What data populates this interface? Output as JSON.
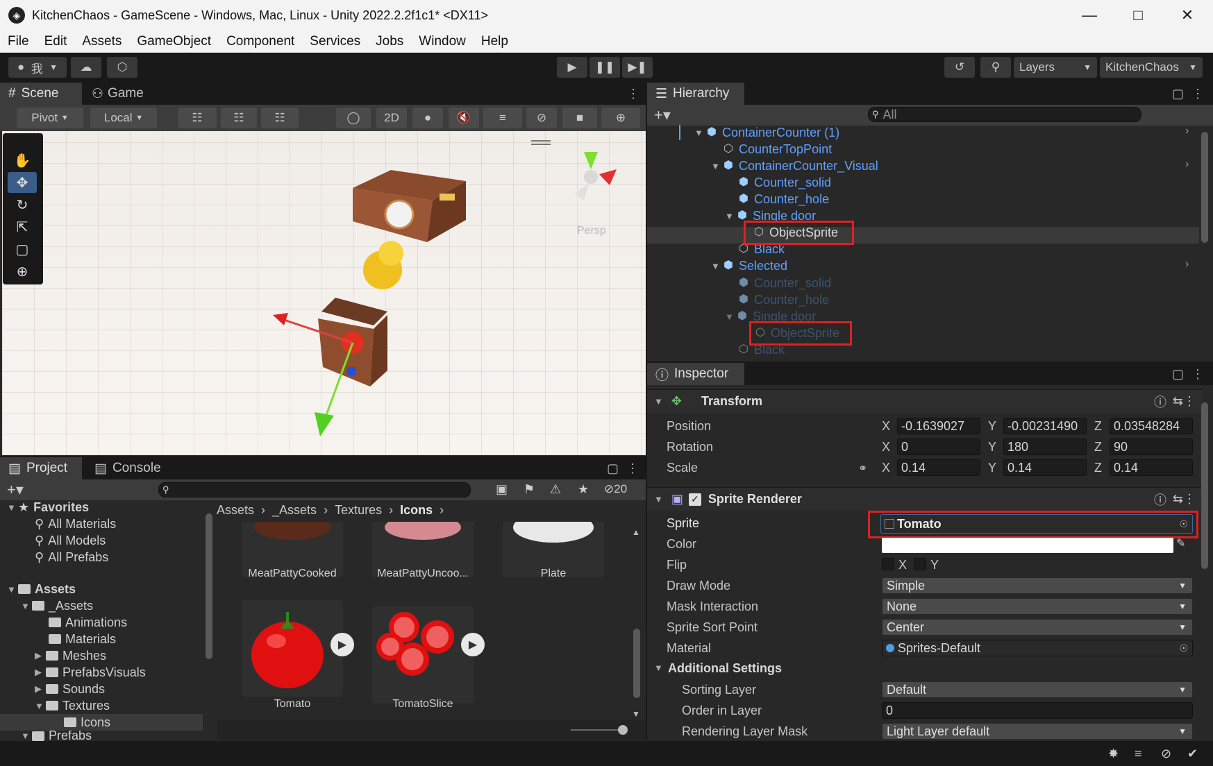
{
  "window": {
    "title": "KitchenChaos - GameScene - Windows, Mac, Linux - Unity 2022.2.2f1c1* <DX11>",
    "minimize_icon": "minimize-icon",
    "maximize_icon": "maximize-icon",
    "close_icon": "close-icon"
  },
  "menu": [
    "File",
    "Edit",
    "Assets",
    "GameObject",
    "Component",
    "Services",
    "Jobs",
    "Window",
    "Help"
  ],
  "toolbar": {
    "account_label": "我",
    "layers_label": "Layers",
    "layout_label": "KitchenChaos"
  },
  "scene": {
    "tabs": [
      "Scene",
      "Game"
    ],
    "pivot_label": "Pivot",
    "local_label": "Local",
    "mode_2d_label": "2D",
    "persp_label": "Persp"
  },
  "hierarchy": {
    "tab": "Hierarchy",
    "search_placeholder": "All",
    "rows": [
      {
        "label": "ContainerCounter (1)",
        "dim": false
      },
      {
        "label": "CounterTopPoint",
        "dim": false
      },
      {
        "label": "ContainerCounter_Visual",
        "dim": false
      },
      {
        "label": "Counter_solid",
        "dim": false
      },
      {
        "label": "Counter_hole",
        "dim": false
      },
      {
        "label": "Single door",
        "dim": false
      },
      {
        "label": "ObjectSprite",
        "dim": false
      },
      {
        "label": "Black",
        "dim": false
      },
      {
        "label": "Selected",
        "dim": false
      },
      {
        "label": "Counter_solid",
        "dim": true
      },
      {
        "label": "Counter_hole",
        "dim": true
      },
      {
        "label": "Single door",
        "dim": true
      },
      {
        "label": "ObjectSprite",
        "dim": true
      },
      {
        "label": "Black",
        "dim": true
      }
    ]
  },
  "inspector": {
    "tab": "Inspector",
    "transform": {
      "title": "Transform",
      "position_label": "Position",
      "rotation_label": "Rotation",
      "scale_label": "Scale",
      "position": {
        "x": "-0.1639027",
        "y": "-0.00231490",
        "z": "0.03548284"
      },
      "rotation": {
        "x": "0",
        "y": "180",
        "z": "90"
      },
      "scale": {
        "x": "0.14",
        "y": "0.14",
        "z": "0.14"
      }
    },
    "sprite_renderer": {
      "title": "Sprite Renderer",
      "sprite_label": "Sprite",
      "sprite_value": "Tomato",
      "color_label": "Color",
      "color_value": "#ffffff",
      "flip_label": "Flip",
      "flip_x": "X",
      "flip_y": "Y",
      "draw_mode_label": "Draw Mode",
      "draw_mode_value": "Simple",
      "mask_label": "Mask Interaction",
      "mask_value": "None",
      "sort_point_label": "Sprite Sort Point",
      "sort_point_value": "Center",
      "material_label": "Material",
      "material_value": "Sprites-Default",
      "additional_label": "Additional Settings",
      "sorting_layer_label": "Sorting Layer",
      "sorting_layer_value": "Default",
      "order_label": "Order in Layer",
      "order_value": "0",
      "rendering_mask_label": "Rendering Layer Mask",
      "rendering_mask_value": "Light Layer default"
    },
    "axis_x": "X",
    "axis_y": "Y",
    "axis_z": "Z"
  },
  "project": {
    "tabs": [
      "Project",
      "Console"
    ],
    "hidden_count": "20",
    "favorites_label": "Favorites",
    "favorites": [
      "All Materials",
      "All Models",
      "All Prefabs"
    ],
    "assets_label": "Assets",
    "tree": [
      {
        "label": "_Assets",
        "level": 1
      },
      {
        "label": "Animations",
        "level": 2
      },
      {
        "label": "Materials",
        "level": 2
      },
      {
        "label": "Meshes",
        "level": 2
      },
      {
        "label": "PrefabsVisuals",
        "level": 2
      },
      {
        "label": "Sounds",
        "level": 2
      },
      {
        "label": "Textures",
        "level": 2
      },
      {
        "label": "Icons",
        "level": 3
      },
      {
        "label": "Prefabs",
        "level": 1
      }
    ],
    "breadcrumb": [
      "Assets",
      "_Assets",
      "Textures",
      "Icons"
    ],
    "assets": [
      "MeatPattyCooked",
      "MeatPattyUncoo...",
      "Plate",
      "Tomato",
      "TomatoSlice"
    ]
  },
  "colors": {
    "accent_blue": "#5ea1ff",
    "highlight_red": "#e02020",
    "panel_bg": "#282828"
  }
}
